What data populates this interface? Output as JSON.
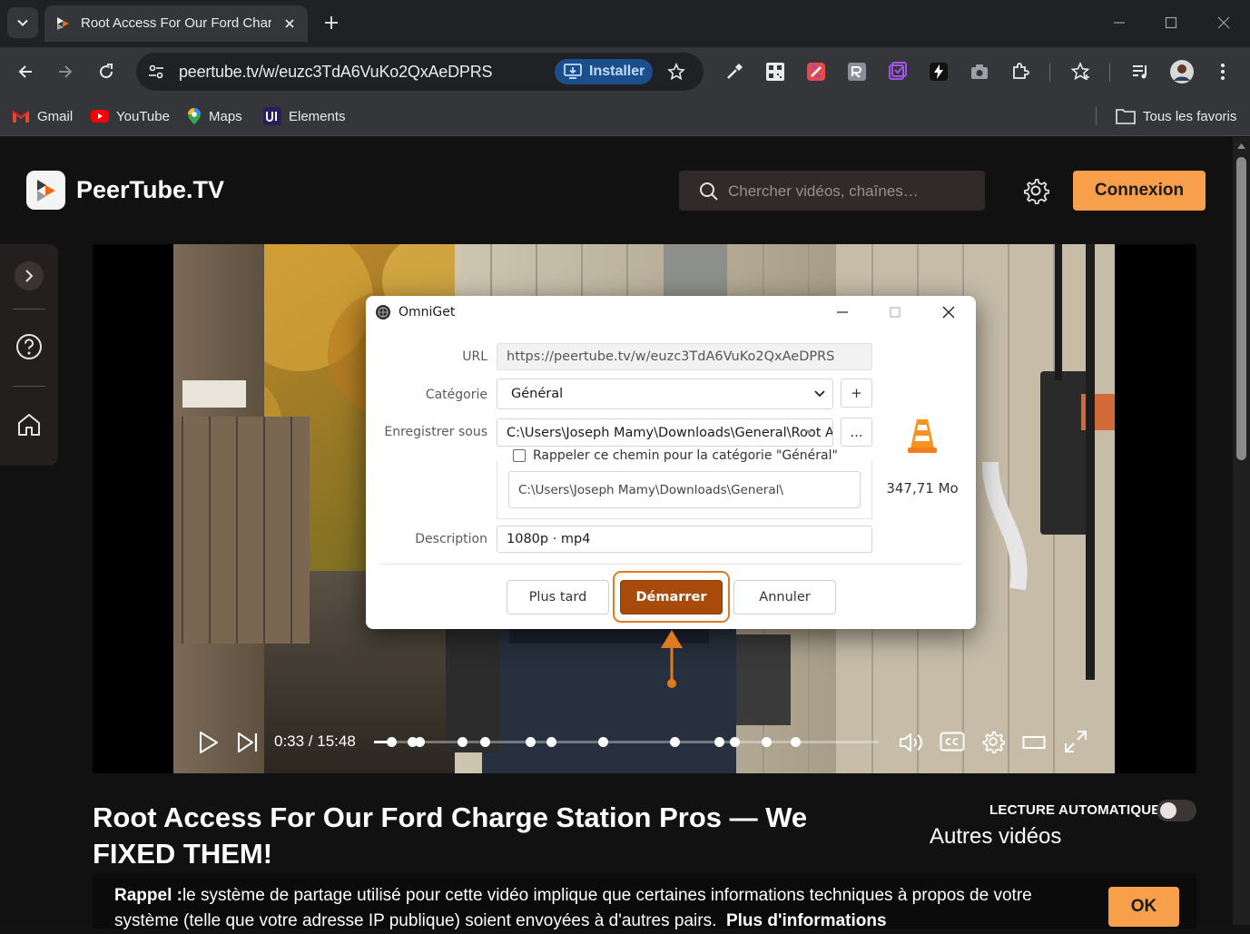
{
  "browser": {
    "tab_title": "Root Access For Our Ford Charge Station Pros",
    "url": "peertube.tv/w/euzc3TdA6VuKo2QxAeDPRS",
    "install_label": "Installer",
    "bookmarks": [
      "Gmail",
      "YouTube",
      "Maps",
      "Elements"
    ],
    "all_bookmarks": "Tous les favoris"
  },
  "site": {
    "logo_text": "PeerTube.TV",
    "search_placeholder": "Chercher vidéos, chaînes…",
    "login_label": "Connexion"
  },
  "player": {
    "time": "0:33 / 15:48",
    "progress": 0.035
  },
  "video": {
    "title": "Root Access For Our Ford Charge Station Pros — We FIXED THEM!",
    "autoplay_label": "LECTURE AUTOMATIQUE",
    "other_videos": "Autres vidéos"
  },
  "notice": {
    "bold": "Rappel :",
    "text": "le système de partage utilisé pour cette vidéo implique que certaines informations techniques à propos de votre système (telle que votre adresse IP publique) soient envoyées à d'autres pairs.",
    "link": "Plus d'informations",
    "ok": "OK"
  },
  "dialog": {
    "title": "OmniGet",
    "url_label": "URL",
    "url_value": "https://peertube.tv/w/euzc3TdA6VuKo2QxAeDPRS",
    "category_label": "Catégorie",
    "category_value": "Général",
    "add_label": "+",
    "save_label": "Enregistrer sous",
    "save_value": "C:\\Users\\Joseph Mamy\\Downloads\\General\\Root Access For Our Ford Charge Station Pros",
    "browse_label": "...",
    "remember_label": "Rappeler ce chemin pour la catégorie \"Général\"",
    "remember_path": "C:\\Users\\Joseph Mamy\\Downloads\\General\\",
    "file_size": "347,71 Mo",
    "description_label": "Description",
    "description_value": "1080p · mp4",
    "later_label": "Plus tard",
    "start_label": "Démarrer",
    "cancel_label": "Annuler"
  },
  "colors": {
    "accent": "#f89f4c",
    "start_button": "#a84a0a",
    "highlight": "#e07a1f"
  }
}
